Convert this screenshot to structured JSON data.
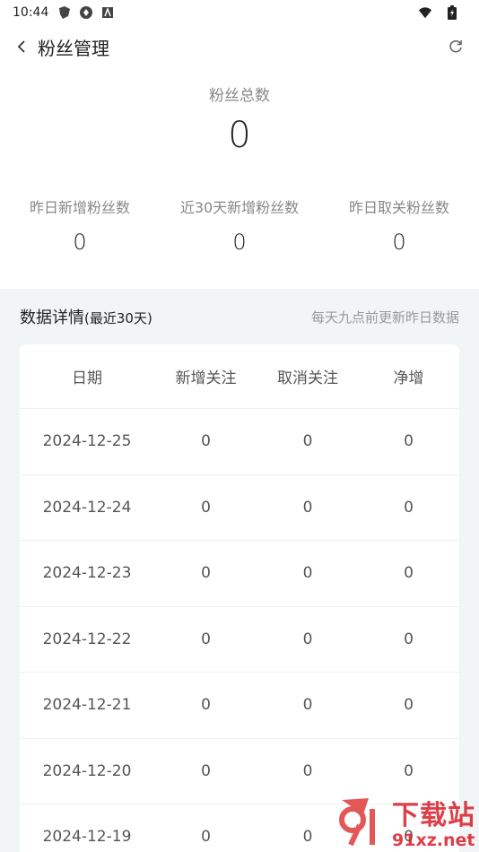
{
  "status_bar": {
    "time": "10:44"
  },
  "header": {
    "title": "粉丝管理"
  },
  "summary": {
    "total_label": "粉丝总数",
    "total_value": "0",
    "stats": [
      {
        "label": "昨日新增粉丝数",
        "value": "0"
      },
      {
        "label": "近30天新增粉丝数",
        "value": "0"
      },
      {
        "label": "昨日取关粉丝数",
        "value": "0"
      }
    ]
  },
  "details": {
    "title": "数据详情",
    "subtitle": "(最近30天)",
    "note": "每天九点前更新昨日数据",
    "columns": [
      "日期",
      "新增关注",
      "取消关注",
      "净增"
    ],
    "rows": [
      [
        "2024-12-25",
        "0",
        "0",
        "0"
      ],
      [
        "2024-12-24",
        "0",
        "0",
        "0"
      ],
      [
        "2024-12-23",
        "0",
        "0",
        "0"
      ],
      [
        "2024-12-22",
        "0",
        "0",
        "0"
      ],
      [
        "2024-12-21",
        "0",
        "0",
        "0"
      ],
      [
        "2024-12-20",
        "0",
        "0",
        "0"
      ],
      [
        "2024-12-19",
        "0",
        "0",
        "0"
      ]
    ]
  },
  "watermark": {
    "cn": "下载站",
    "en": "91xz.net"
  },
  "colors": {
    "accent_bg": "#f1f5f6",
    "watermark": "#d81e2a"
  }
}
